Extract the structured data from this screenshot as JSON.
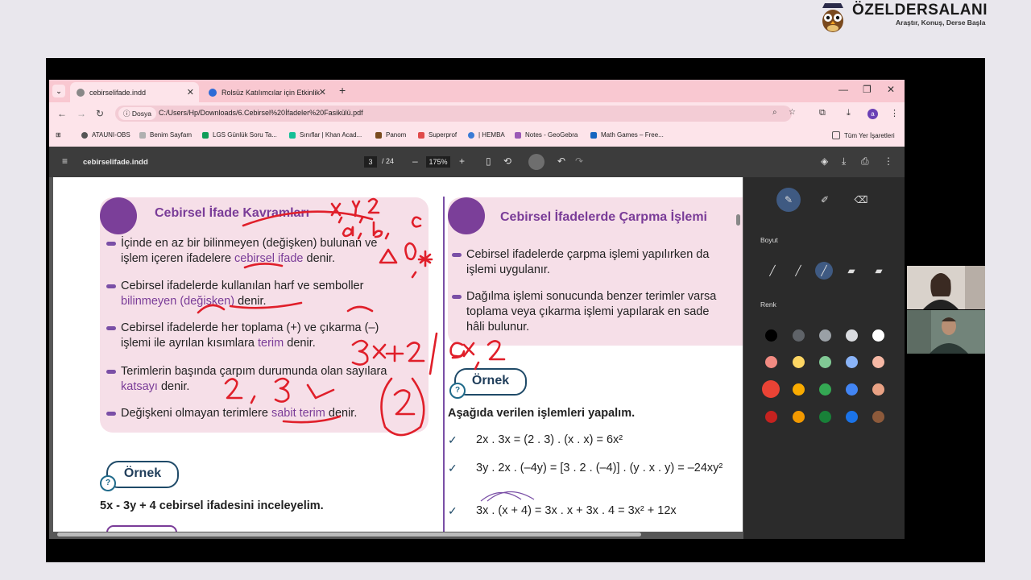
{
  "brand": {
    "name": "ÖZELDERSALANI",
    "slogan": "Araştır, Konuş, Derse Başla"
  },
  "browser": {
    "tabs": [
      {
        "label": "cebirselifade.indd"
      },
      {
        "label": "Rolsüz Katılımcılar için Etkinlik"
      }
    ],
    "address": {
      "chip": "Dosya",
      "url": "C:/Users/Hp/Downloads/6.Cebirsel%20İfadeler%20Fasikülü.pdf",
      "avatar_letter": "a"
    },
    "bookmarks": [
      "ATAUNI-OBS",
      "Benim Sayfam",
      "LGS Günlük Soru Ta...",
      "Sınıflar | Khan Acad...",
      "Panom",
      "Superprof",
      "| HEMBA",
      "Notes - GeoGebra",
      "Math Games – Free..."
    ],
    "all_bookmarks": "Tüm Yer İşaretleri"
  },
  "pdf": {
    "title": "cebirselifade.indd",
    "page": "3",
    "total": "/ 24",
    "zoom": "175%"
  },
  "doc": {
    "left": {
      "title": "Cebirsel İfade Kavramları",
      "b1": {
        "t1": "İçinde en az bir bilinmeyen (değişken) bulunan ve",
        "t2": "işlem içeren ifadelere ",
        "hl": "cebirsel ifade",
        "t3": " denir."
      },
      "b2": {
        "t1": "Cebirsel ifadelerde kullanılan harf ve semboller",
        "hl": "bilinmeyen (değişken)",
        "t2": " denir."
      },
      "b3": {
        "t1": "Cebirsel ifadelerde her toplama (+) ve çıkarma (–)",
        "t2": "işlemi ile ayrılan kısımlara ",
        "hl": "terim",
        "t3": " denir."
      },
      "b4": {
        "t1": "Terimlerin başında çarpım durumunda olan sayılara",
        "hl": "katsayı",
        "t2": " denir."
      },
      "b5": {
        "t1": "Değişkeni olmayan terimlere ",
        "hl": "sabit terim",
        "t2": " denir."
      },
      "example_label": "Örnek",
      "example_text": "5x - 3y + 4 cebirsel ifadesini inceleyelim."
    },
    "right": {
      "title": "Cebirsel İfadelerde Çarpma İşlemi",
      "b1": {
        "t1": "Cebirsel ifadelerde çarpma işlemi yapılırken da",
        "t2": "işlemi uygulanır."
      },
      "b2": {
        "t1": "Dağılma işlemi sonucunda benzer terimler varsa",
        "t2": "toplama veya çıkarma işlemi yapılarak en sade",
        "t3": "hâli bulunur."
      },
      "example_label": "Örnek",
      "instruction": "Aşağıda verilen işlemleri yapalım.",
      "ops": [
        "2x . 3x = (2 . 3) . (x . x) = 6x²",
        "3y . 2x . (–4y) = [3 . 2 . (–4)] . (y . x . y) = –24xy²",
        "3x . (x + 4) = 3x . x + 3x . 4 = 3x² + 12x"
      ]
    }
  },
  "annotation_panel": {
    "size_label": "Boyut",
    "color_label": "Renk",
    "colors": [
      "#000000",
      "#5f6368",
      "#9aa0a6",
      "#dadce0",
      "#ffffff",
      "#f28b82",
      "#fdd663",
      "#81c995",
      "#8ab4f8",
      "#f6b8a5",
      "#ea4335",
      "#f9ab00",
      "#34a853",
      "#4285f4",
      "#e8a184",
      "#c5221f",
      "#f29900",
      "#188038",
      "#1a73e8",
      "#8d5a3b"
    ]
  }
}
